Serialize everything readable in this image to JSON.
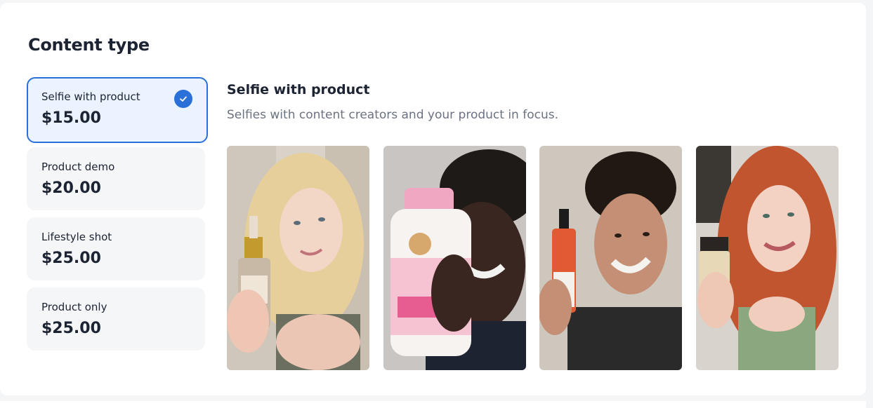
{
  "section": {
    "title": "Content type"
  },
  "options": [
    {
      "label": "Selfie with product",
      "price": "$15.00",
      "selected": true
    },
    {
      "label": "Product demo",
      "price": "$20.00",
      "selected": false
    },
    {
      "label": "Lifestyle shot",
      "price": "$25.00",
      "selected": false
    },
    {
      "label": "Product only",
      "price": "$25.00",
      "selected": false
    }
  ],
  "detail": {
    "title": "Selfie with product",
    "description": "Selfies with content creators and your product in focus."
  },
  "colors": {
    "accent": "#2b6fd8",
    "selected_bg": "#eaf3ff",
    "option_bg": "#f5f6f7",
    "text": "#1c2333",
    "muted_text": "#6b7280"
  },
  "icons": {
    "selected_check": "check-circle-icon"
  },
  "gallery": [
    {
      "name": "photo-serum-dropper"
    },
    {
      "name": "photo-multivitamin-bottle"
    },
    {
      "name": "photo-spray-bottle"
    },
    {
      "name": "photo-cinnamon-jar"
    }
  ]
}
